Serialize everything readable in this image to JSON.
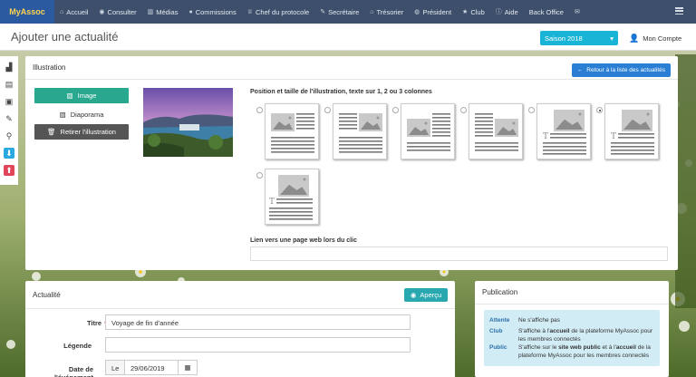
{
  "app": {
    "logo": "MyAssoc"
  },
  "nav": [
    {
      "label": "Accueil",
      "icon": "home-icon",
      "glyph": "⌂"
    },
    {
      "label": "Consulter",
      "icon": "eye-icon",
      "glyph": "◉"
    },
    {
      "label": "Médias",
      "icon": "book-icon",
      "glyph": "▥"
    },
    {
      "label": "Commissions",
      "icon": "users-icon",
      "glyph": "●"
    },
    {
      "label": "Chef du protocole",
      "icon": "trophy-icon",
      "glyph": "♕"
    },
    {
      "label": "Secrétaire",
      "icon": "pencil-icon",
      "glyph": "✎"
    },
    {
      "label": "Trésorier",
      "icon": "bank-icon",
      "glyph": "⌂"
    },
    {
      "label": "Président",
      "icon": "globe-icon",
      "glyph": "◍"
    },
    {
      "label": "Club",
      "icon": "star-icon",
      "glyph": "★"
    },
    {
      "label": "Aide",
      "icon": "info-icon",
      "glyph": "ⓘ"
    },
    {
      "label": "Back Office",
      "icon": "",
      "glyph": ""
    },
    {
      "label": "",
      "icon": "envelope-icon",
      "glyph": "✉"
    }
  ],
  "header": {
    "title": "Ajouter une actualité",
    "season": "Saison 2018",
    "account": "Mon Compte"
  },
  "illustration": {
    "heading": "Illustration",
    "back_button": "Retour à la liste des actualités",
    "image_button": "Image",
    "diaporama_button": "Diaporama",
    "remove_button": "Retirer l'illustration",
    "position_label": "Position et taille de l'illustration, texte sur 1, 2 ou 3 colonnes",
    "selected_layout": 6,
    "link_label": "Lien vers une page web lors du clic",
    "link_value": ""
  },
  "actualite": {
    "heading": "Actualité",
    "preview_button": "Aperçu",
    "title_label": "Titre",
    "title_value": "Voyage de fin d'année",
    "legend_label": "Légende",
    "legend_value": "",
    "date_label": "Date de l'événement",
    "date_prefix": "Le",
    "date_value": "29/06/2019"
  },
  "publication": {
    "heading": "Publication",
    "rows": [
      {
        "key": "Attente",
        "value": "Ne s'affiche pas"
      },
      {
        "key": "Club",
        "value_parts": [
          "S'affiche à l'",
          "accueil",
          " de la plateforme MyAssoc pour les membres connectés"
        ]
      },
      {
        "key": "Public",
        "value_parts": [
          "S'affiche sur le ",
          "site web public",
          " et à l'",
          "accueil",
          " de la plateforme MyAssoc pour les membres connectés"
        ]
      }
    ]
  },
  "colors": {
    "topbar": "#3d4f6b",
    "accent_green": "#2aa88f",
    "season": "#1ab5d6",
    "back_button": "#2a7fd4"
  }
}
